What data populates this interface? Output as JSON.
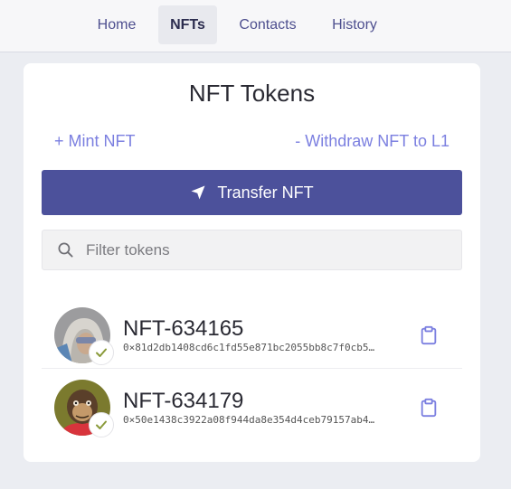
{
  "nav": {
    "tabs": [
      {
        "label": "Home"
      },
      {
        "label": "NFTs"
      },
      {
        "label": "Contacts"
      },
      {
        "label": "History"
      }
    ],
    "active": "NFTs"
  },
  "card": {
    "title": "NFT Tokens",
    "mint_link": "+ Mint NFT",
    "withdraw_link": "- Withdraw NFT to L1",
    "transfer_button": "Transfer NFT",
    "filter_placeholder": "Filter tokens"
  },
  "tokens": [
    {
      "name": "NFT-634165",
      "address": "0×81d2db1408cd6c1fd55e871bc2055bb8c7f0cb5…",
      "avatar_icon": "hooded-figure-avatar",
      "verified_icon": "check-icon"
    },
    {
      "name": "NFT-634179",
      "address": "0×50e1438c3922a08f944da8e354d4ceb79157ab4…",
      "avatar_icon": "ape-avatar",
      "verified_icon": "check-icon"
    }
  ],
  "colors": {
    "accent": "#4c519b",
    "link": "#7b7fe0",
    "nav_text": "#4e4f8f",
    "check": "#8a9a3a"
  }
}
